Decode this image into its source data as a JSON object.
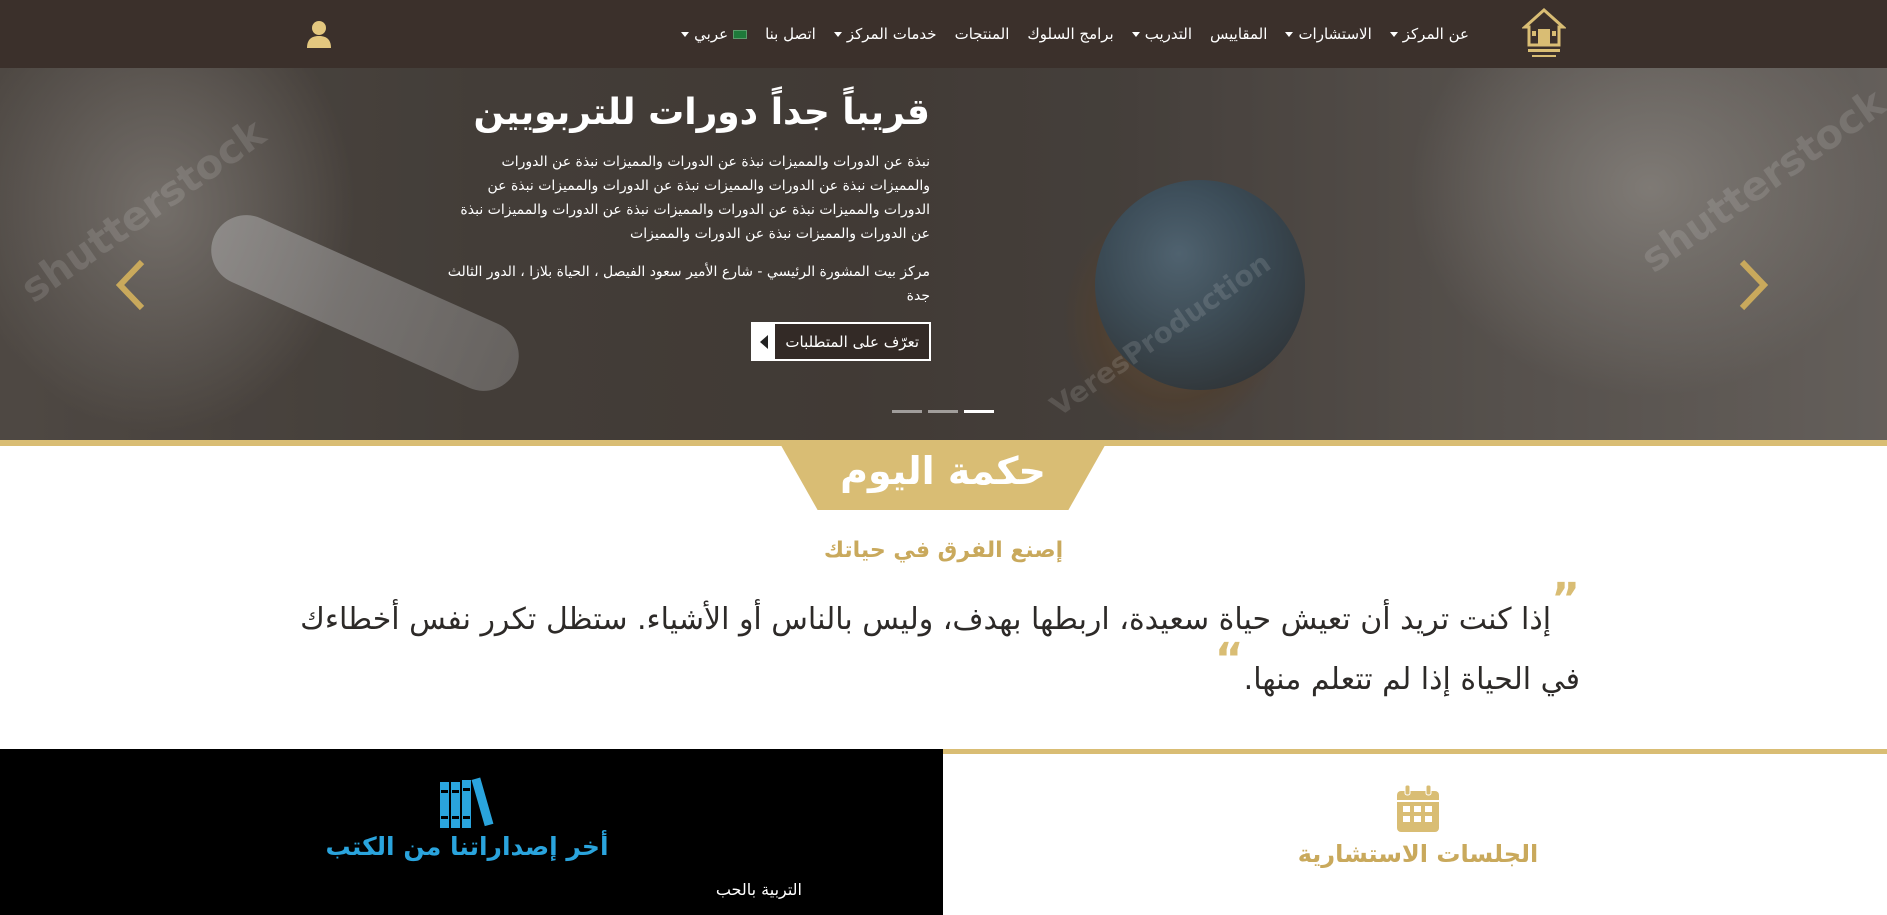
{
  "nav": {
    "menu": [
      {
        "label": "عن المركز",
        "caret": true
      },
      {
        "label": "الاستشارات",
        "caret": true
      },
      {
        "label": "المقاييس",
        "caret": false
      },
      {
        "label": "التدريب",
        "caret": true
      },
      {
        "label": "برامج السلوك",
        "caret": false
      },
      {
        "label": "المنتجات",
        "caret": false
      },
      {
        "label": "خدمات المركز",
        "caret": true
      },
      {
        "label": "اتصل بنا",
        "caret": false
      },
      {
        "label": "عربي",
        "caret": true
      }
    ],
    "logo_icon": "house-logo-icon",
    "user_icon": "user-icon"
  },
  "hero": {
    "title": "قريباً جداً دورات للتربويين",
    "description": "نبذة عن الدورات والمميزات نبذة عن الدورات والمميزات نبذة عن الدورات والمميزات نبذة عن الدورات والمميزات نبذة عن الدورات والمميزات نبذة عن الدورات والمميزات نبذة عن الدورات والمميزات نبذة عن الدورات والمميزات نبذة عن الدورات والمميزات نبذة عن الدورات والمميزات",
    "address": "مركز بيت المشورة الرئيسي - شارع الأمير سعود الفيصل ، الحياة بلازا ، الدور الثالث جدة",
    "button_label": "تعرّف على المتطلبات",
    "active_slide": 3,
    "slide_count": 3
  },
  "wisdom": {
    "title": "حكمة اليوم",
    "subtitle": "إصنع الفرق في حياتك",
    "quote": "إذا كنت تريد أن تعيش حياة سعيدة، اربطها بهدف، وليس بالناس أو الأشياء. ستظل تكرر نفس أخطاءك في الحياة إذا لم تتعلم منها."
  },
  "books": {
    "title": "أخر إصداراتنا من الكتب",
    "item": "التربية بالحب",
    "icon": "books-icon"
  },
  "sessions": {
    "title": "الجلسات الاستشارية",
    "icon": "calendar-icon"
  },
  "colors": {
    "nav_bg": "#3b302b",
    "gold": "#d9bd74",
    "blue": "#2aa4dd"
  }
}
